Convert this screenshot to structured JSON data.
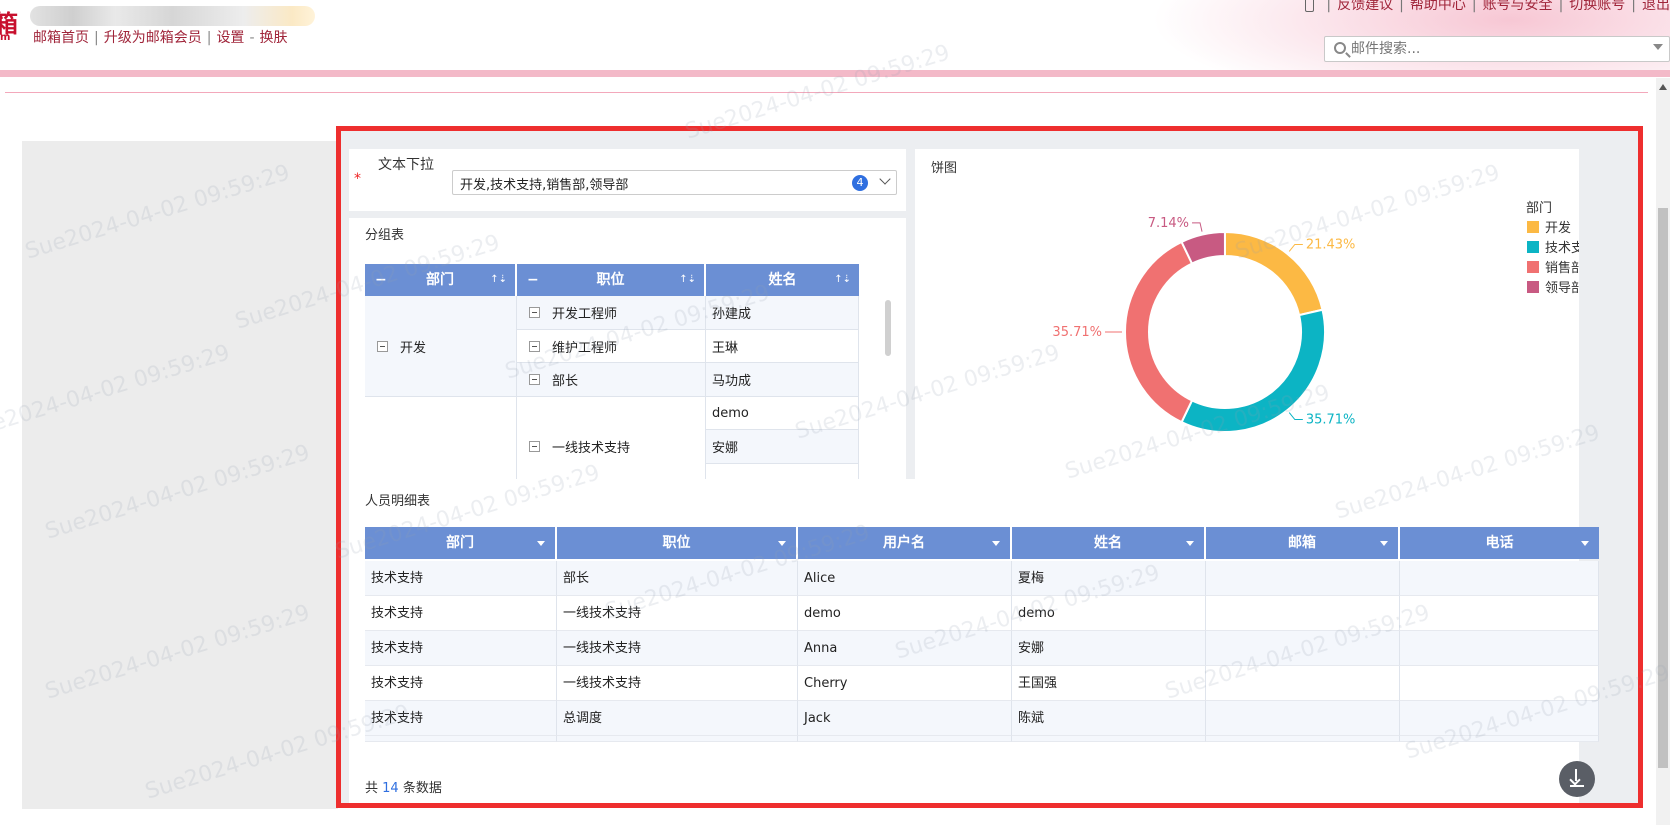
{
  "header": {
    "logo_glyph": "箱",
    "logo_sub": "m",
    "nav": [
      "邮箱首页",
      "升级为邮箱会员",
      "设置",
      "换肤"
    ],
    "nav_separators": [
      "|",
      "|",
      "-"
    ],
    "top_links": [
      "反馈建议",
      "帮助中心",
      "账号与安全",
      "切换账号",
      "退出"
    ],
    "search_placeholder": "邮件搜索..."
  },
  "filter": {
    "required_mark": "*",
    "label": "文本下拉",
    "value": "开发,技术支持,销售部,领导部",
    "count": "4"
  },
  "group_table": {
    "title": "分组表",
    "minus": "−",
    "sort_icon": "↑⇣",
    "headers": [
      "部门",
      "职位",
      "姓名"
    ],
    "dept": "开发",
    "positions": [
      "开发工程师",
      "维护工程师",
      "部长",
      "一线技术支持"
    ],
    "names": [
      "孙建成",
      "王琳",
      "马功成",
      "demo",
      "安娜"
    ]
  },
  "pie": {
    "title": "饼图",
    "legend_title": "部门"
  },
  "chart_data": {
    "type": "pie",
    "title": "饼图",
    "legend_title": "部门",
    "legend_position": "right",
    "donut": true,
    "slices": [
      {
        "label": "开发",
        "percent": 21.43,
        "value_label": "21.43%",
        "color": "#fcb944"
      },
      {
        "label": "技术支持",
        "percent": 35.71,
        "value_label": "35.71%",
        "color": "#0cb4c4"
      },
      {
        "label": "销售部",
        "percent": 35.71,
        "value_label": "35.71%",
        "color": "#f07171"
      },
      {
        "label": "领导部",
        "percent": 7.14,
        "value_label": "7.14%",
        "color": "#c85a82"
      }
    ]
  },
  "detail_table": {
    "title": "人员明细表",
    "headers": [
      "部门",
      "职位",
      "用户名",
      "姓名",
      "邮箱",
      "电话"
    ],
    "rows": [
      [
        "技术支持",
        "部长",
        "Alice",
        "夏梅",
        "",
        ""
      ],
      [
        "技术支持",
        "一线技术支持",
        "demo",
        "demo",
        "",
        ""
      ],
      [
        "技术支持",
        "一线技术支持",
        "Anna",
        "安娜",
        "",
        ""
      ],
      [
        "技术支持",
        "一线技术支持",
        "Cherry",
        "王国强",
        "",
        ""
      ],
      [
        "技术支持",
        "总调度",
        "Jack",
        "陈斌",
        "",
        ""
      ]
    ],
    "footer_prefix": "共",
    "footer_count": "14",
    "footer_suffix": "条数据"
  },
  "watermark": "Sue2024-04-02 09:59:29"
}
